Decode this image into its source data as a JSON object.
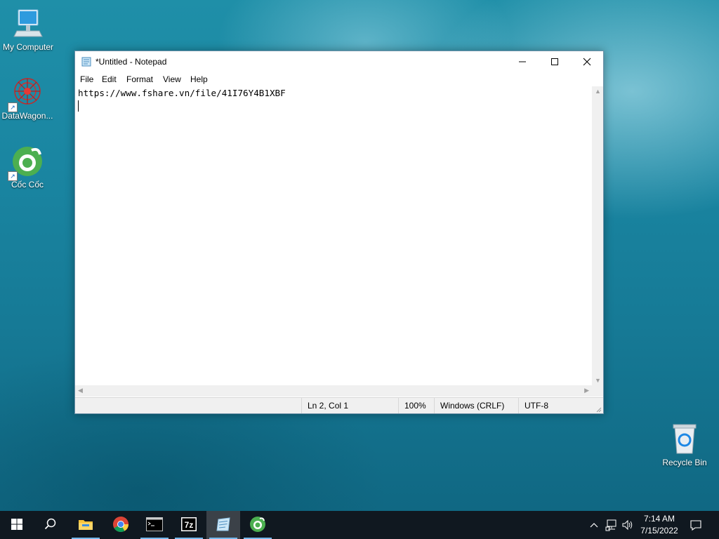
{
  "desktop": {
    "icons": [
      {
        "label": "My Computer",
        "icon": "my-computer-icon"
      },
      {
        "label": "DataWagon...",
        "icon": "datawagon-icon"
      },
      {
        "label": "Cốc Cốc",
        "icon": "coccoc-browser-icon"
      },
      {
        "label": "Recycle Bin",
        "icon": "recycle-bin-icon"
      }
    ]
  },
  "window": {
    "title": "*Untitled - Notepad",
    "menu": [
      "File",
      "Edit",
      "Format",
      "View",
      "Help"
    ],
    "content": "https://www.fshare.vn/file/41I76Y4B1XBF",
    "status": {
      "position": "Ln 2, Col 1",
      "zoom": "100%",
      "line_ending": "Windows (CRLF)",
      "encoding": "UTF-8"
    }
  },
  "taskbar": {
    "apps": [
      "start-windows-icon",
      "search-icon",
      "file-explorer-icon",
      "chrome-icon",
      "terminal-icon",
      "7zip-icon",
      "notepad-icon",
      "coccoc-icon"
    ],
    "active_app": "notepad-icon",
    "time": "7:14 AM",
    "date": "7/15/2022"
  },
  "colors": {
    "taskbar": "#101820",
    "accent": "#76b9ed",
    "desktop": "#1a86a2"
  }
}
